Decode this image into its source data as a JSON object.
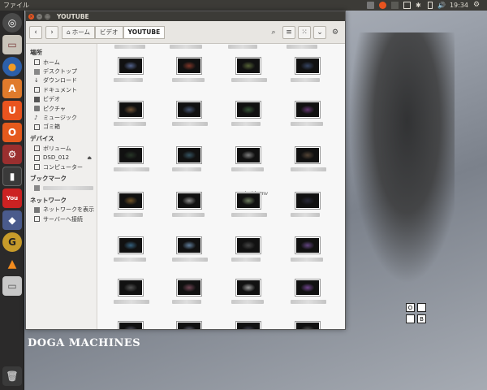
{
  "panel": {
    "menu": "ファイル",
    "clock": "19:34"
  },
  "window": {
    "title": "YOUTUBE",
    "breadcrumb": [
      "ホーム",
      "ビデオ",
      "YOUTUBE"
    ]
  },
  "sidebar": {
    "places_header": "場所",
    "places": [
      "ホーム",
      "デスクトップ",
      "ダウンロード",
      "ドキュメント",
      "ビデオ",
      "ピクチャ",
      "ミュージック",
      "ゴミ箱"
    ],
    "devices_header": "デバイス",
    "devices": [
      "ボリューム",
      "DSD_012",
      "コンピューター"
    ],
    "bookmarks_header": "ブックマーク",
    "network_header": "ネットワーク",
    "network": [
      "ネットワークを表示",
      "サーバーへ接続"
    ]
  },
  "content": {
    "visible_label": "inside.mv"
  },
  "desktop": {
    "logo": "DOGA MACHINES",
    "block_a": "O",
    "block_b": "B"
  },
  "colors": {
    "accent": "#e9541f",
    "panel": "#3c3b37",
    "close": "#e9541f"
  }
}
